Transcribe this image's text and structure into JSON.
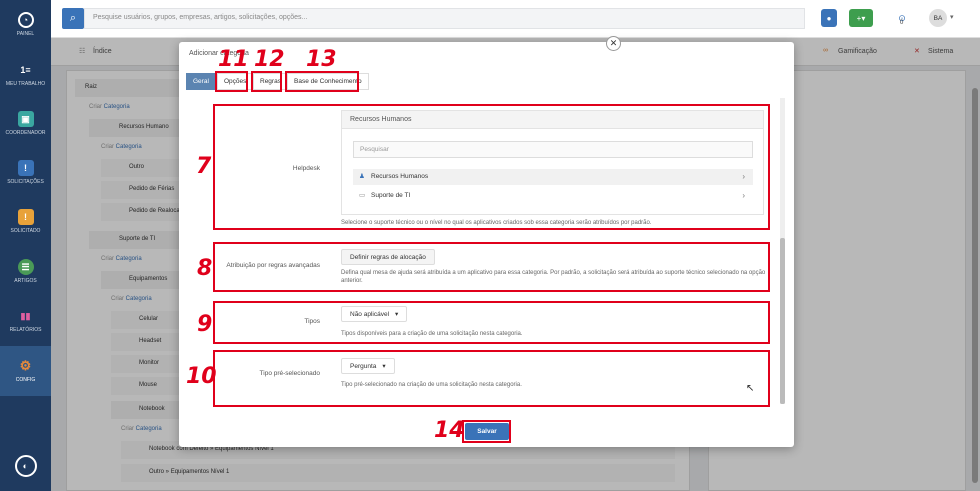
{
  "sidebar": {
    "items": [
      {
        "label": "PAINEL",
        "icon": "dashboard-icon"
      },
      {
        "label": "MEU TRABALHO",
        "icon": "list-numbered-icon"
      },
      {
        "label": "COORDENADOR",
        "icon": "coordinator-icon"
      },
      {
        "label": "SOLICITAÇÕES",
        "icon": "requests-icon"
      },
      {
        "label": "SOLICITADO",
        "icon": "requested-icon"
      },
      {
        "label": "ARTIGOS",
        "icon": "articles-icon"
      },
      {
        "label": "RELATÓRIOS",
        "icon": "reports-icon"
      },
      {
        "label": "CONFIG",
        "icon": "config-icon"
      }
    ]
  },
  "topbar": {
    "search_placeholder": "Pesquise usuários, grupos, empresas, artigos, solicitações, opções...",
    "notif_count": "0",
    "avatar": "BA"
  },
  "navbar": {
    "items": [
      "Índice",
      "Gamificação",
      "Sistema"
    ]
  },
  "tree": {
    "root": "Raiz",
    "create": "Criar",
    "category": "Categoria",
    "rows": [
      "Recursos Humano",
      "Outro",
      "Pedido de Férias",
      "Pedido de Realoca",
      "Suporte de TI",
      "Equipamentos",
      "Celular",
      "Headset",
      "Monitor",
      "Mouse",
      "Notebook",
      "Notebook com Defeito",
      "Outro"
    ],
    "suffix": "Equipamentos Nível 1"
  },
  "modal": {
    "title": "Adicionar categoria",
    "tabs": [
      "Geral",
      "Opções",
      "Regras",
      "Base de Conhecimento"
    ],
    "helpdesk": {
      "label": "Helpdesk",
      "selected": "Recursos Humanos",
      "search_placeholder": "Pesquisar",
      "options": [
        "Recursos Humanos",
        "Suporte de TI"
      ],
      "help": "Selecione o suporte técnico ou o nível no qual os aplicativos criados sob essa categoria serão atribuídos por padrão."
    },
    "assignment": {
      "label": "Atribuição por regras avançadas",
      "button": "Definir regras de alocação",
      "help": "Defina qual mesa de ajuda será atribuída a um aplicativo para essa categoria. Por padrão, a solicitação será atribuída ao suporte técnico selecionado na opção anterior."
    },
    "types": {
      "label": "Tipos",
      "value": "Não aplicável",
      "help": "Tipos disponíveis para a criação de uma solicitação nesta categoria."
    },
    "preselected": {
      "label": "Tipo pré-selecionado",
      "value": "Pergunta",
      "help": "Tipo pré-selecionado na criação de uma solicitação nesta categoria."
    },
    "save": "Salvar"
  },
  "annotations": [
    "7",
    "8",
    "9",
    "10",
    "11",
    "12",
    "13",
    "14"
  ]
}
